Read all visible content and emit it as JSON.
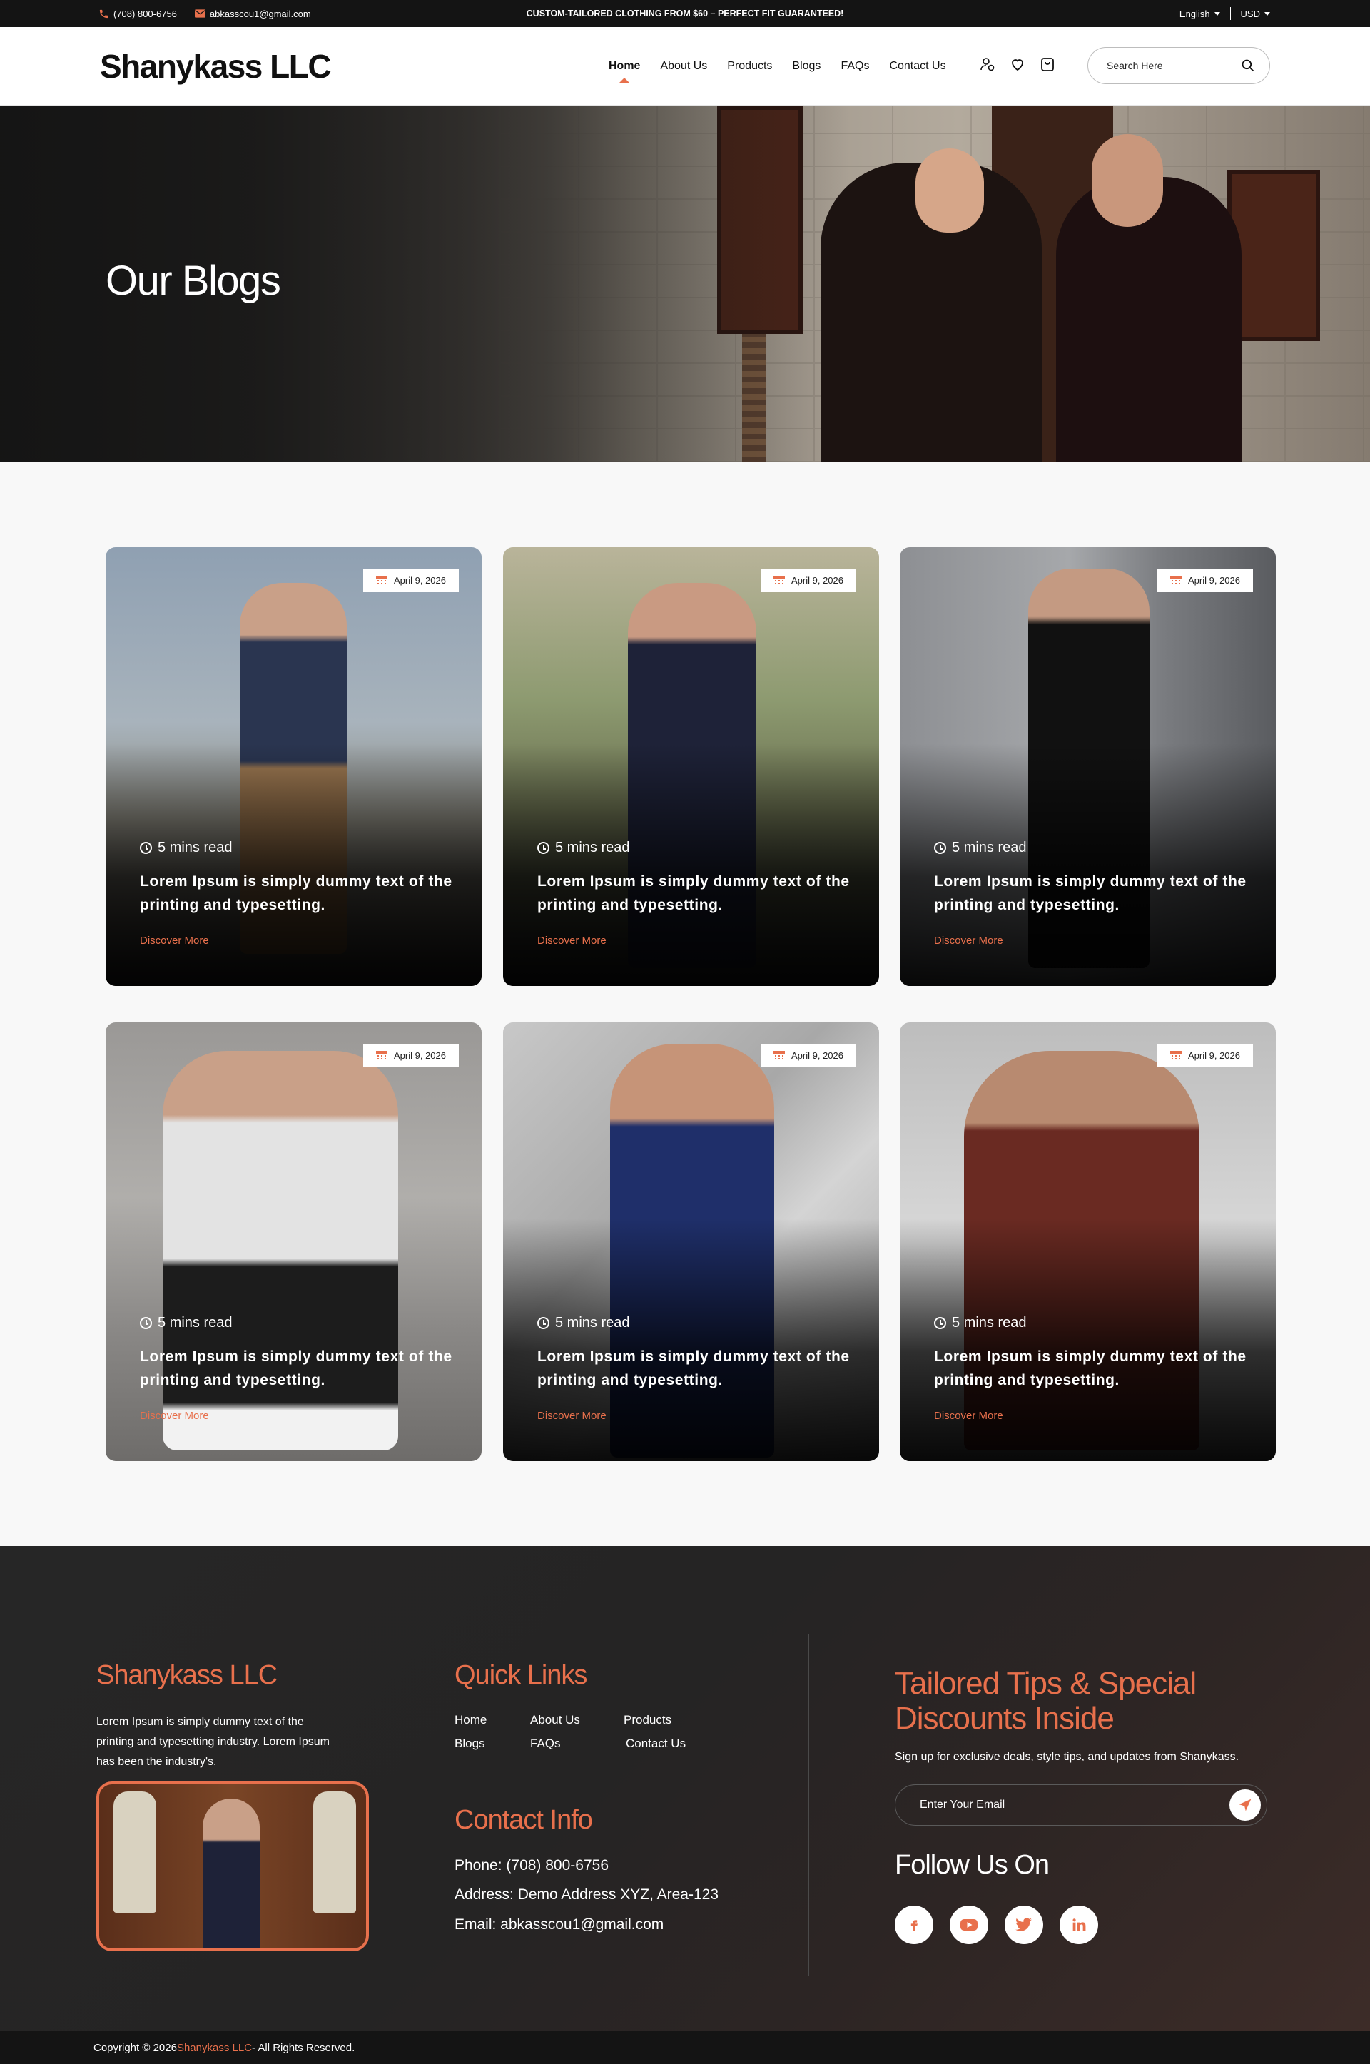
{
  "topbar": {
    "phone": "(708) 800-6756",
    "email": "abkasscou1@gmail.com",
    "promo": "CUSTOM-TAILORED CLOTHING FROM $60 – PERFECT FIT GUARANTEED!",
    "language": "English",
    "currency": "USD"
  },
  "header": {
    "logo": "Shanykass LLC",
    "nav": [
      "Home",
      "About Us",
      "Products",
      "Blogs",
      "FAQs",
      "Contact Us"
    ],
    "active_nav": "Home",
    "search_placeholder": "Search Here"
  },
  "hero": {
    "title": "Our Blogs"
  },
  "blogs": [
    {
      "date": "April 9, 2026",
      "read": "5 mins read",
      "title": "Lorem Ipsum is simply dummy text of the printing and typesetting.",
      "link": "Discover More"
    },
    {
      "date": "April 9, 2026",
      "read": "5 mins read",
      "title": "Lorem Ipsum is simply dummy text of the printing and typesetting.",
      "link": "Discover More"
    },
    {
      "date": "April 9, 2026",
      "read": "5 mins read",
      "title": "Lorem Ipsum is simply dummy text of the printing and typesetting.",
      "link": "Discover More"
    },
    {
      "date": "April 9, 2026",
      "read": "5 mins read",
      "title": "Lorem Ipsum is simply dummy text of the printing and typesetting.",
      "link": "Discover More"
    },
    {
      "date": "April 9, 2026",
      "read": "5 mins read",
      "title": "Lorem Ipsum is simply dummy text of the printing and typesetting.",
      "link": "Discover More"
    },
    {
      "date": "April 9, 2026",
      "read": "5 mins read",
      "title": "Lorem Ipsum is simply dummy text of the printing and typesetting.",
      "link": "Discover More"
    }
  ],
  "footer": {
    "brand": "Shanykass LLC",
    "description": "Lorem Ipsum is simply dummy text of the printing and typesetting industry. Lorem Ipsum has been the industry's.",
    "quick_links_title": "Quick Links",
    "quick_links": [
      "Home",
      "About Us",
      "Products",
      "Blogs",
      "FAQs",
      "Contact Us"
    ],
    "contact_title": "Contact Info",
    "phone": "Phone: (708) 800-6756",
    "address": "Address: Demo Address XYZ, Area-123",
    "email": "Email: abkasscou1@gmail.com",
    "newsletter_title": "Tailored Tips & Special Discounts Inside",
    "newsletter_sub": "Sign up for exclusive deals, style tips, and updates from Shanykass.",
    "email_placeholder": "Enter Your Email",
    "follow_title": "Follow Us On",
    "socials": [
      "facebook-icon",
      "youtube-icon",
      "twitter-icon",
      "linkedin-icon"
    ]
  },
  "copyright": {
    "prefix": "Copyright © 2026 ",
    "brand": "Shanykass LLC",
    "suffix": " - All Rights Reserved."
  },
  "colors": {
    "accent": "#e8704c",
    "dark": "#141414"
  }
}
